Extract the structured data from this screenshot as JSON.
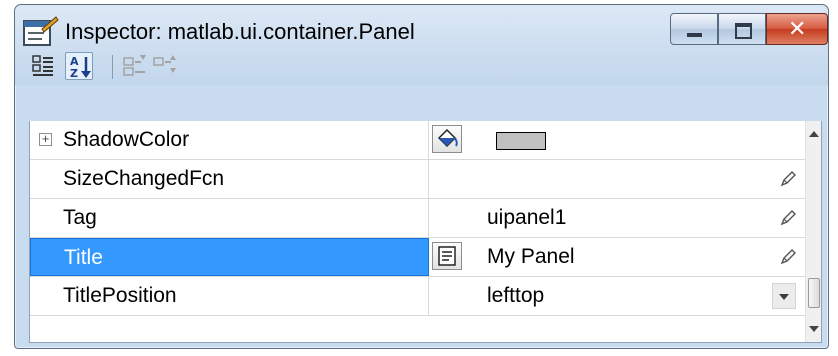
{
  "window": {
    "title": "Inspector:  matlab.ui.container.Panel",
    "title_icon": "inspector-properties-icon",
    "buttons": [
      {
        "name": "minimize",
        "icon": "minimize-icon"
      },
      {
        "name": "maximize",
        "icon": "maximize-icon"
      },
      {
        "name": "close",
        "icon": "close-icon",
        "glyph": "✕"
      }
    ]
  },
  "toolbar": {
    "items": [
      {
        "name": "categorized-view",
        "icon": "categorized-view-icon",
        "active": false
      },
      {
        "name": "sort-alphabetical",
        "icon": "sort-alphabetical-icon",
        "active": true
      },
      {
        "name": "expand-all",
        "icon": "expand-all-icon",
        "active": false,
        "enabled": false
      },
      {
        "name": "collapse-all",
        "icon": "collapse-all-icon",
        "active": false,
        "enabled": false
      }
    ]
  },
  "properties": [
    {
      "name": "ShadowColor",
      "value": "",
      "expandable": true,
      "expander_glyph": "+",
      "editor": "color-picker-button",
      "swatch_color": "#c0c0c0"
    },
    {
      "name": "SizeChangedFcn",
      "value": "",
      "editable_icon": "pencil-icon"
    },
    {
      "name": "Tag",
      "value": "uipanel1",
      "editable_icon": "pencil-icon"
    },
    {
      "name": "Title",
      "value": "My Panel",
      "selected": true,
      "editor": "text-editor-button",
      "editable_icon": "pencil-icon"
    },
    {
      "name": "TitlePosition",
      "value": "lefttop",
      "editor": "dropdown"
    }
  ],
  "colors": {
    "selection": "#3399ff",
    "window_frame": "#c9dbee",
    "close_button": "#c63c20"
  }
}
